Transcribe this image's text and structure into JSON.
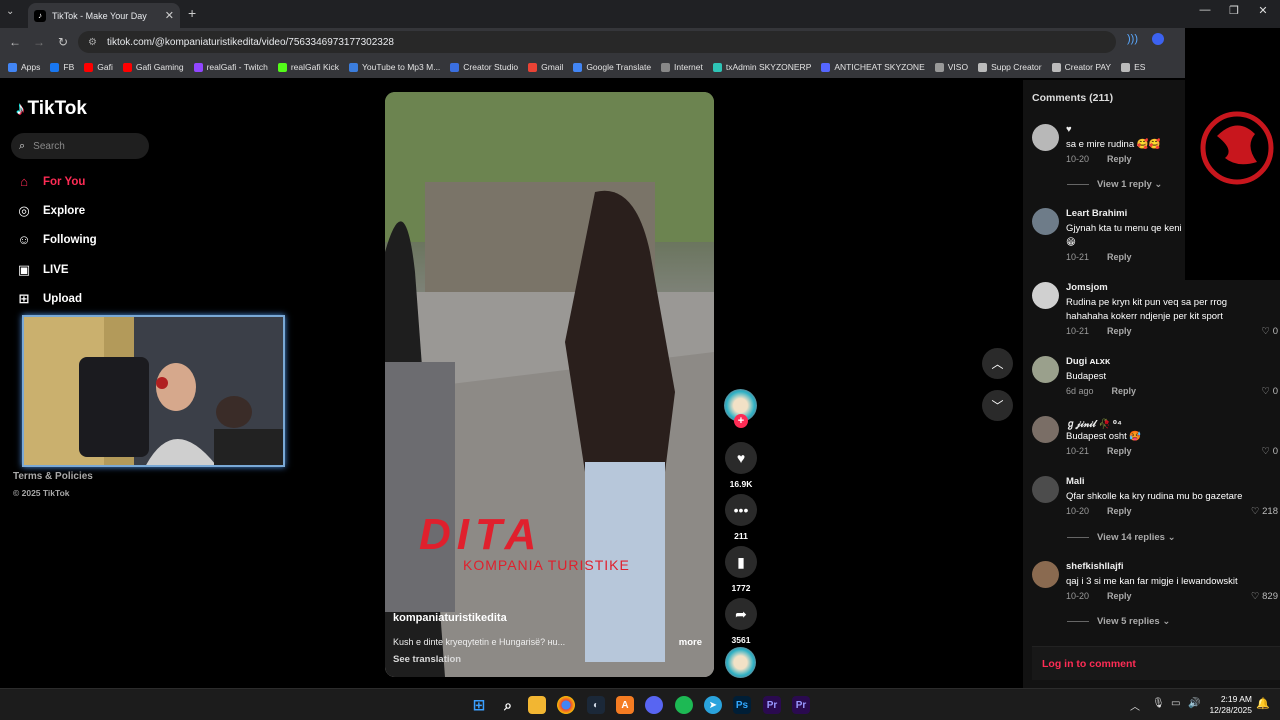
{
  "browser": {
    "tab_title": "TikTok - Make Your Day",
    "url": "tiktok.com/@kompaniaturistikedita/video/7563346973177302328",
    "bookmarks": [
      {
        "label": "Apps",
        "color": "#4285f4"
      },
      {
        "label": "FB",
        "color": "#1877f2"
      },
      {
        "label": "Gafi",
        "color": "#ff0000"
      },
      {
        "label": "Gafi Gaming",
        "color": "#ff0000"
      },
      {
        "label": "realGafi - Twitch",
        "color": "#9146ff"
      },
      {
        "label": "realGafi Kick",
        "color": "#53fc18"
      },
      {
        "label": "YouTube to Mp3 M...",
        "color": "#3b7ddd"
      },
      {
        "label": "Creator Studio",
        "color": "#3a6fe0"
      },
      {
        "label": "Gmail",
        "color": "#ea4335"
      },
      {
        "label": "Google Translate",
        "color": "#4285f4"
      },
      {
        "label": "Internet",
        "color": "#888888"
      },
      {
        "label": "txAdmin SKYZONERP",
        "color": "#2ec4b6"
      },
      {
        "label": "ANTICHEAT SKYZONE",
        "color": "#5566ff"
      },
      {
        "label": "VISO",
        "color": "#999999"
      },
      {
        "label": "Supp Creator",
        "color": "#bbbbbb"
      },
      {
        "label": "Creator PAY",
        "color": "#bbbbbb"
      },
      {
        "label": "ES",
        "color": "#bbbbbb"
      }
    ]
  },
  "sidebar": {
    "logo": "TikTok",
    "search_placeholder": "Search",
    "items": [
      {
        "label": "For You",
        "icon": "home-icon"
      },
      {
        "label": "Explore",
        "icon": "compass-icon"
      },
      {
        "label": "Following",
        "icon": "user-icon"
      },
      {
        "label": "LIVE",
        "icon": "live-icon"
      },
      {
        "label": "Upload",
        "icon": "plus-square-icon"
      }
    ],
    "terms": "Terms & Policies",
    "copyright": "© 2025 TikTok"
  },
  "video": {
    "overlay_title": "DITA",
    "overlay_subtitle": "KOMPANIA TURISTIKE",
    "author": "kompaniaturistikedita",
    "description": "Kush e dinte kryeqytetin e Hungarisë? нu...",
    "more": "more",
    "see_translation": "See translation"
  },
  "actions": {
    "likes": "16.9K",
    "comments": "211",
    "saves": "1772",
    "shares": "3561"
  },
  "comments": {
    "title": "Comments (211)",
    "items": [
      {
        "name": "♥",
        "text": "sa e mire rudina 🥰🥰",
        "date": "10-20",
        "reply": "Reply",
        "likes": "",
        "view_replies": "View 1 reply"
      },
      {
        "name": "Leart Brahimi",
        "text": "Gjynah kta tu menu qe keni 😁",
        "date": "10-21",
        "reply": "Reply",
        "likes": "",
        "view_replies": ""
      },
      {
        "name": "Jomsjom",
        "text": "Rudina pe kryn kit pun veq sa per rrog hahahaha kokerr ndjenje per kit sport",
        "date": "10-21",
        "reply": "Reply",
        "likes": "0",
        "view_replies": ""
      },
      {
        "name": "Dugi ᴀʟxᴋ",
        "text": "Budapest",
        "date": "6d ago",
        "reply": "Reply",
        "likes": "0",
        "view_replies": ""
      },
      {
        "name": "ℊ𝒿𝒾𝓃𝒾𝓁 🥀 ⁰⁴",
        "text": "Budapest osht 🥵",
        "date": "10-21",
        "reply": "Reply",
        "likes": "0",
        "view_replies": ""
      },
      {
        "name": "Mali",
        "text": "Qfar shkolle ka kry rudina mu bo gazetare",
        "date": "10-20",
        "reply": "Reply",
        "likes": "218",
        "view_replies": "View 14 replies"
      },
      {
        "name": "shefkishllajfi",
        "text": "qaj i 3 si me kan far migje i lewandowskit",
        "date": "10-20",
        "reply": "Reply",
        "likes": "829",
        "view_replies": "View 5 replies"
      }
    ],
    "login_prompt": "Log in to comment"
  },
  "taskbar": {
    "time": "2:19 AM",
    "date": "12/28/2025"
  }
}
